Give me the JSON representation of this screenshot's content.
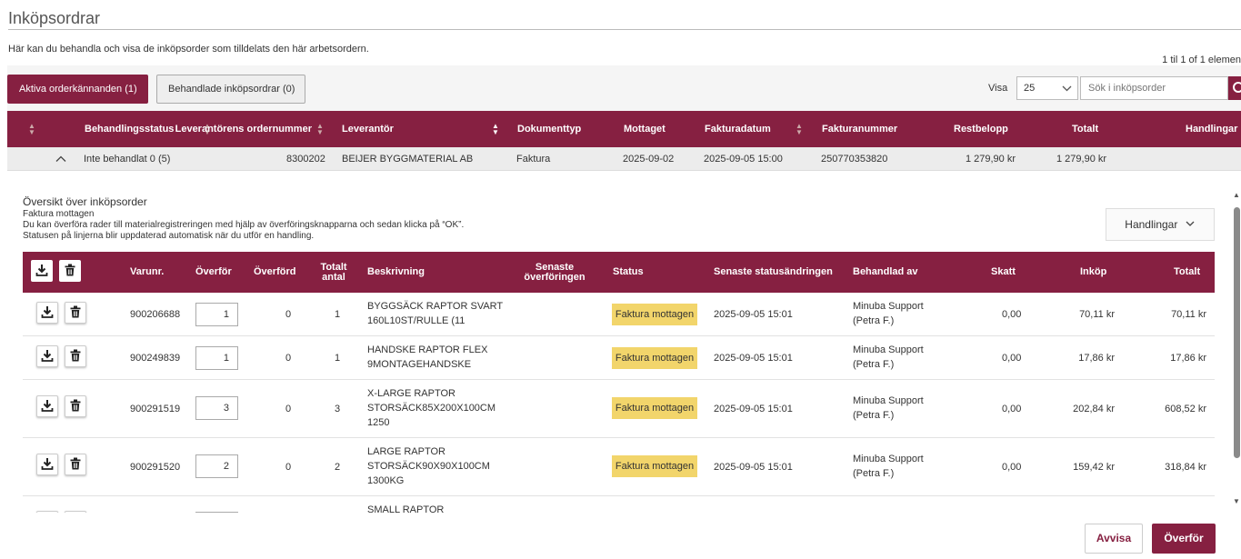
{
  "page": {
    "title": "Inköpsordrar",
    "subtitle": "Här kan du behandla och visa de inköpsorder som tilldelats den här arbetsordern.",
    "pager_info": "1 til 1 of 1 elemen"
  },
  "toolbar": {
    "tab_active": "Aktiva orderkännanden (1)",
    "tab_inactive": "Behandlade inköpsordrar (0)",
    "visa_label": "Visa",
    "visa_value": "25",
    "search_placeholder": "Sök i inköpsorder"
  },
  "main_table": {
    "headers": {
      "status": "Behandlingsstatus",
      "supplier_order_no": "Leverantörens ordernummer",
      "supplier": "Leverantör",
      "doc_type": "Dokumenttyp",
      "received": "Mottaget",
      "invoice_date": "Fakturadatum",
      "invoice_no": "Fakturanummer",
      "remaining": "Restbelopp",
      "total": "Totalt",
      "actions": "Handlingar"
    },
    "row": {
      "status": "Inte behandlat 0 (5)",
      "supplier_order_no": "8300202",
      "supplier": "BEIJER BYGGMATERIAL AB",
      "doc_type": "Faktura",
      "received": "2025-09-02",
      "invoice_date": "2025-09-05 15:00",
      "invoice_no": "250770353820",
      "remaining": "1 279,90 kr",
      "total": "1 279,90 kr"
    }
  },
  "overview": {
    "title": "Översikt över inköpsorder",
    "line1": "Faktura mottagen",
    "line2": "Du kan överföra rader till materialregistreringen med hjälp av överföringsknapparna och sedan klicka på “OK”.",
    "line3": "Statusen på linjerna blir uppdaterad automatisk när du utför en handling.",
    "actions_label": "Handlingar"
  },
  "sub_table": {
    "headers": {
      "item_no": "Varunr.",
      "transfer": "Överför",
      "transferred": "Överförd",
      "total_qty": "Totalt antal",
      "description": "Beskrivning",
      "last_transfer": "Senaste överföringen",
      "status": "Status",
      "last_status_change": "Senaste statusändringen",
      "handled_by": "Behandlad av",
      "tax": "Skatt",
      "purchase": "Inköp",
      "total": "Totalt"
    },
    "rows": [
      {
        "item_no": "900206688",
        "transfer": "1",
        "transferred": "0",
        "total_qty": "1",
        "desc1": "BYGGSÄCK RAPTOR SVART",
        "desc2": "160L10ST/RULLE (11",
        "desc3": "",
        "status": "Faktura mottagen",
        "last_status_change": "2025-09-05 15:01",
        "handled1": "Minuba Support",
        "handled2": "(Petra F.)",
        "tax": "0,00",
        "purchase": "70,11 kr",
        "total": "70,11 kr"
      },
      {
        "item_no": "900249839",
        "transfer": "1",
        "transferred": "0",
        "total_qty": "1",
        "desc1": "HANDSKE RAPTOR FLEX",
        "desc2": "9MONTAGEHANDSKE",
        "desc3": "",
        "status": "Faktura mottagen",
        "last_status_change": "2025-09-05 15:01",
        "handled1": "Minuba Support",
        "handled2": "(Petra F.)",
        "tax": "0,00",
        "purchase": "17,86 kr",
        "total": "17,86 kr"
      },
      {
        "item_no": "900291519",
        "transfer": "3",
        "transferred": "0",
        "total_qty": "3",
        "desc1": "X-LARGE RAPTOR",
        "desc2": "STORSÄCK85X200X100CM",
        "desc3": "1250",
        "status": "Faktura mottagen",
        "last_status_change": "2025-09-05 15:01",
        "handled1": "Minuba Support",
        "handled2": "(Petra F.)",
        "tax": "0,00",
        "purchase": "202,84 kr",
        "total": "608,52 kr"
      },
      {
        "item_no": "900291520",
        "transfer": "2",
        "transferred": "0",
        "total_qty": "2",
        "desc1": "LARGE RAPTOR",
        "desc2": "STORSÄCK90X90X100CM",
        "desc3": "1300KG",
        "status": "Faktura mottagen",
        "last_status_change": "2025-09-05 15:01",
        "handled1": "Minuba Support",
        "handled2": "(Petra F.)",
        "tax": "0,00",
        "purchase": "159,42 kr",
        "total": "318,84 kr"
      },
      {
        "item_no": "",
        "transfer": "",
        "transferred": "",
        "total_qty": "",
        "desc1": "SMALL RAPTOR",
        "desc2": "",
        "desc3": "",
        "status": "",
        "last_status_change": "",
        "handled1": "",
        "handled2": "",
        "tax": "",
        "purchase": "",
        "total": ""
      }
    ]
  },
  "footer": {
    "reject": "Avvisa",
    "transfer": "Överför"
  },
  "icons": {
    "download": "download-icon",
    "trash": "trash-icon",
    "sort": "sort-arrows-icon",
    "chevron_up": "chevron-up-icon",
    "chevron_down": "chevron-down-icon",
    "search": "search-icon"
  },
  "colors": {
    "brand": "#862041",
    "status_badge": "#f2d56b",
    "toolbar_bg": "#f5f5f5"
  }
}
